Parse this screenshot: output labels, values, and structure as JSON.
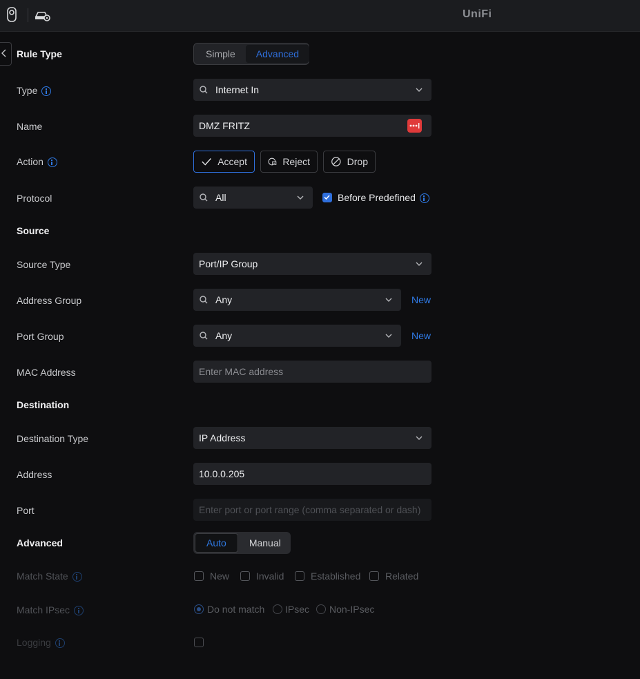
{
  "app": {
    "logo": "UniFi"
  },
  "rule_type": {
    "label": "Rule Type",
    "options": [
      "Simple",
      "Advanced"
    ],
    "selected": "Advanced"
  },
  "type": {
    "label": "Type",
    "value": "Internet In"
  },
  "name": {
    "label": "Name",
    "value": "DMZ FRITZ"
  },
  "action": {
    "label": "Action",
    "options": [
      "Accept",
      "Reject",
      "Drop"
    ],
    "selected": "Accept"
  },
  "protocol": {
    "label": "Protocol",
    "value": "All",
    "before_predefined_label": "Before Predefined",
    "before_predefined_checked": true
  },
  "source": {
    "heading": "Source",
    "source_type_label": "Source Type",
    "source_type_value": "Port/IP Group",
    "address_group_label": "Address Group",
    "address_group_value": "Any",
    "port_group_label": "Port Group",
    "port_group_value": "Any",
    "new_label": "New",
    "mac_label": "MAC Address",
    "mac_placeholder": "Enter MAC address"
  },
  "destination": {
    "heading": "Destination",
    "type_label": "Destination Type",
    "type_value": "IP Address",
    "address_label": "Address",
    "address_value": "10.0.0.205",
    "port_label": "Port",
    "port_placeholder": "Enter port or port range (comma separated or dash)"
  },
  "advanced": {
    "heading": "Advanced",
    "options": [
      "Auto",
      "Manual"
    ],
    "selected": "Auto",
    "match_state_label": "Match State",
    "match_state_options": [
      "New",
      "Invalid",
      "Established",
      "Related"
    ],
    "match_ipsec_label": "Match IPsec",
    "match_ipsec_options": [
      "Do not match",
      "IPsec",
      "Non-IPsec"
    ],
    "match_ipsec_selected": "Do not match",
    "logging_label": "Logging",
    "logging_checked": false
  },
  "colors": {
    "accent": "#2f6fdc",
    "background": "#0e0e10",
    "field": "#222327",
    "danger": "#e03a3a"
  }
}
